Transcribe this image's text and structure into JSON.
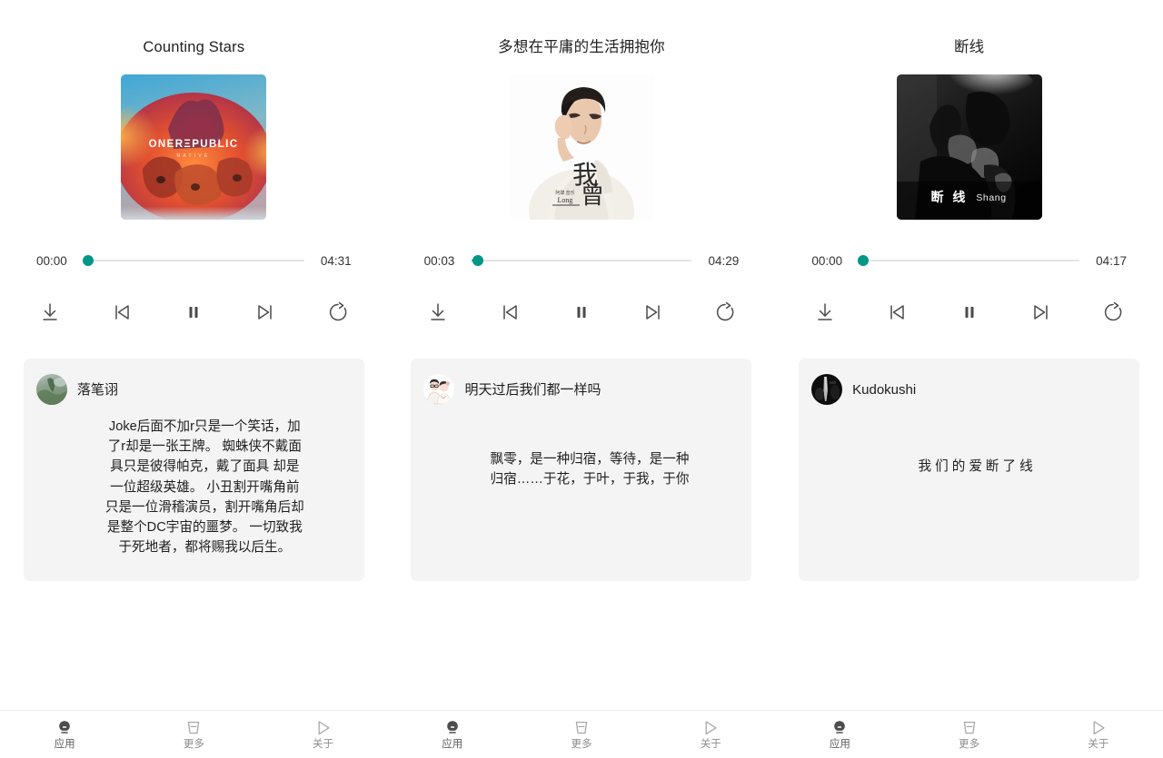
{
  "panels": [
    {
      "song_title": "Counting Stars",
      "album_art_alt": "OneRepublic Native album cover",
      "time_current": "00:00",
      "time_total": "04:31",
      "progress_percent": 2,
      "controls": [
        {
          "name": "download-icon",
          "label": "Download"
        },
        {
          "name": "previous-track-icon",
          "label": "Previous"
        },
        {
          "name": "pause-icon",
          "label": "Pause"
        },
        {
          "name": "next-track-icon",
          "label": "Next"
        },
        {
          "name": "repeat-icon",
          "label": "Repeat"
        }
      ],
      "comment": {
        "user": "落笔诩",
        "avatar": "landscape-avatar",
        "text": "Joke后面不加r只是一个笑话，加\n了r却是一张王牌。 蜘蛛侠不戴面\n具只是彼得帕克，戴了面具 却是\n一位超级英雄。 小丑割开嘴角前\n只是一位滑稽演员，割开嘴角后却\n是整个DC宇宙的噩梦。 一切致我\n于死地者，都将赐我以后生。",
        "style": "top"
      }
    },
    {
      "song_title": "多想在平庸的生活拥抱你",
      "album_art_alt": "我曾 Long single cover",
      "time_current": "00:03",
      "time_total": "04:29",
      "progress_percent": 3,
      "controls": [
        {
          "name": "download-icon",
          "label": "Download"
        },
        {
          "name": "previous-track-icon",
          "label": "Previous"
        },
        {
          "name": "pause-icon",
          "label": "Pause"
        },
        {
          "name": "next-track-icon",
          "label": "Next"
        },
        {
          "name": "repeat-icon",
          "label": "Repeat"
        }
      ],
      "comment": {
        "user": "明天过后我们都一样吗",
        "avatar": "couple-illustration-avatar",
        "text": "飘零，是一种归宿，等待，是一种\n归宿……于花，于叶，于我，于你",
        "style": "mid"
      }
    },
    {
      "song_title": "断线",
      "album_art_alt": "断线 Shang album cover",
      "time_current": "00:00",
      "time_total": "04:17",
      "progress_percent": 2,
      "controls": [
        {
          "name": "download-icon",
          "label": "Download"
        },
        {
          "name": "previous-track-icon",
          "label": "Previous"
        },
        {
          "name": "pause-icon",
          "label": "Pause"
        },
        {
          "name": "next-track-icon",
          "label": "Next"
        },
        {
          "name": "repeat-icon",
          "label": "Repeat"
        }
      ],
      "comment": {
        "user": "Kudokushi",
        "avatar": "dark-portrait-avatar",
        "text": "我们的爱断了线",
        "style": "low-spaced"
      }
    }
  ],
  "bottom_nav": {
    "items": [
      {
        "label": "应用",
        "icon": "apps-bulb-icon",
        "active": true
      },
      {
        "label": "更多",
        "icon": "more-cup-icon",
        "active": false
      },
      {
        "label": "关于",
        "icon": "about-play-icon",
        "active": false
      }
    ]
  },
  "colors": {
    "accent_teal": "#009688",
    "card_background": "#f4f4f4",
    "track_gray": "#e4e4e4",
    "icon_gray": "#4a4a4a",
    "nav_inactive": "#8c8c8c"
  }
}
